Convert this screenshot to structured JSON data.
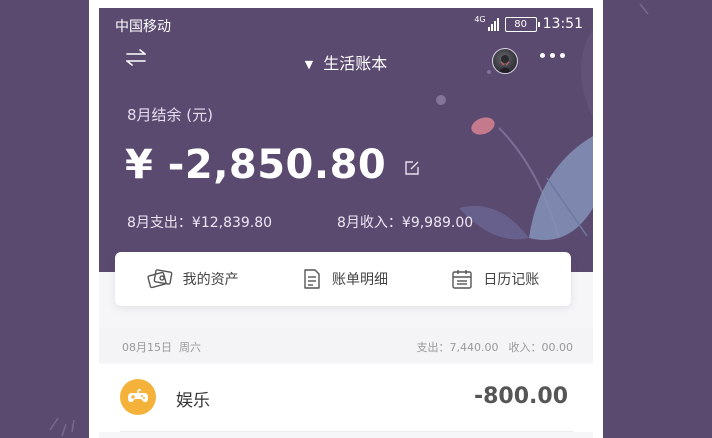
{
  "status_bar": {
    "carrier": "中国移动",
    "network": "4G",
    "battery": "80",
    "time": "13:51"
  },
  "header": {
    "book_name": "生活账本",
    "switch_icon": "swap-arrows-icon",
    "more_icon": "more-dots-icon"
  },
  "summary": {
    "balance_label": "8月结余 (元)",
    "balance_value": "¥ -2,850.80",
    "expense_text": "8月支出：¥12,839.80",
    "income_text": "8月收入：¥9,989.00"
  },
  "quick_actions": [
    {
      "label": "我的资产",
      "icon": "assets-icon"
    },
    {
      "label": "账单明细",
      "icon": "bill-detail-icon"
    },
    {
      "label": "日历记账",
      "icon": "calendar-icon"
    }
  ],
  "day_group": {
    "date": "08月15日",
    "weekday": "周六",
    "expense": "支出：7,440.00",
    "income": "收入：00.00"
  },
  "records": [
    {
      "category": "娱乐",
      "icon": "gamepad-icon",
      "amount": "-800.00"
    }
  ],
  "colors": {
    "page_bg": "#5a4a70",
    "hero_bg": "#5b4a6f",
    "category_accent": "#f4b23a"
  }
}
